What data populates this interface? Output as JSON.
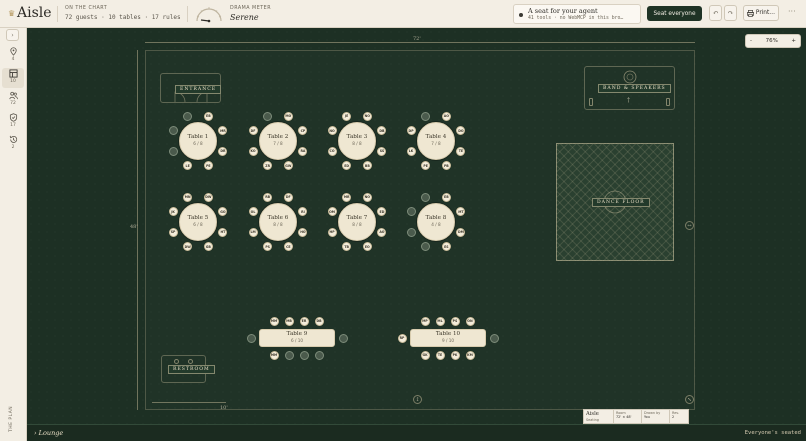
{
  "app": {
    "name": "Aisle"
  },
  "header": {
    "chart_label": "On the chart",
    "chart_stats": "72 guests · 10 tables · 17 rules",
    "drama_label": "Drama meter",
    "drama_value": "Serene",
    "agent_title": "A seat for your agent",
    "agent_sub": "41 tools · no WebMCP in this bro…",
    "seat_button": "Seat everyone",
    "undo_icon": "undo-icon",
    "redo_icon": "redo-icon",
    "print_button": "Print…",
    "more_icon": "more-icon"
  },
  "rail": {
    "items": [
      {
        "icon": "location-pin-icon",
        "count": "4"
      },
      {
        "icon": "tables-icon",
        "count": "10"
      },
      {
        "icon": "people-icon",
        "count": "72"
      },
      {
        "icon": "shield-icon",
        "count": "17"
      },
      {
        "icon": "history-icon",
        "count": "2"
      }
    ],
    "footer": "The Plan"
  },
  "canvas": {
    "zoom": "76%",
    "zoom_minus": "-",
    "zoom_plus": "+",
    "width_dim": "72'",
    "height_dim": "48'",
    "scale_dim": "10'",
    "entrance": "Entrance",
    "band": "Band & Speakers",
    "dance_floor": "Dance Floor",
    "restroom": "Restroom",
    "titleblock": {
      "brand": "Aisle",
      "brand_sub": "Seating",
      "room_label": "Room",
      "room_value": "72' × 48'",
      "drawn_label": "Drawn by",
      "drawn_value": "You",
      "rev_label": "Rev.",
      "rev_value": "2"
    },
    "tables": [
      {
        "name": "Table 1",
        "count": "6 / 8",
        "seats": [
          "EB",
          "MR",
          "DR",
          "PE",
          "LE",
          "",
          "",
          ""
        ]
      },
      {
        "name": "Table 2",
        "count": "7 / 8",
        "seats": [
          "MO",
          "CP",
          "RA",
          "GW",
          "ZR",
          "KO",
          "DF",
          ""
        ]
      },
      {
        "name": "Table 3",
        "count": "8 / 8",
        "seats": [
          "NO",
          "DB",
          "SS",
          "BB",
          "ED",
          "CO",
          "NO",
          "JE"
        ]
      },
      {
        "name": "Table 4",
        "count": "7 / 8",
        "seats": [
          "AO",
          "DO",
          "TE",
          "PB",
          "PE",
          "LK",
          "DP",
          ""
        ]
      },
      {
        "name": "Table 5",
        "count": "6 / 8",
        "seats": [
          "DW",
          "GO",
          "HT",
          "GB",
          "DW",
          "SP",
          "JK",
          "MN"
        ]
      },
      {
        "name": "Table 6",
        "count": "8 / 8",
        "seats": [
          "DF",
          "RI",
          "HO",
          "CE",
          "PS",
          "LM",
          "OL",
          "RB"
        ]
      },
      {
        "name": "Table 7",
        "count": "8 / 8",
        "seats": [
          "NO",
          "ED",
          "AO",
          "EO",
          "TB",
          "HP",
          "OM",
          "MR"
        ]
      },
      {
        "name": "Table 8",
        "count": "4 / 8",
        "seats": [
          "EB",
          "MT",
          "DM",
          "ES",
          "",
          "",
          "",
          ""
        ]
      },
      {
        "name": "Table 9",
        "count": "6 / 10",
        "top": [
          "MM",
          "MB",
          "ER",
          "DB"
        ],
        "bottom": [
          "MM",
          "",
          "",
          ""
        ]
      },
      {
        "name": "Table 10",
        "count": "9 / 10",
        "top": [
          "MP",
          "ML",
          "PS",
          "ON"
        ],
        "bottom": [
          "GK",
          "TE",
          "PK",
          "KM"
        ],
        "left": "RP"
      }
    ]
  },
  "bottom": {
    "venue": "Lounge",
    "status": "Everyone's seated"
  }
}
